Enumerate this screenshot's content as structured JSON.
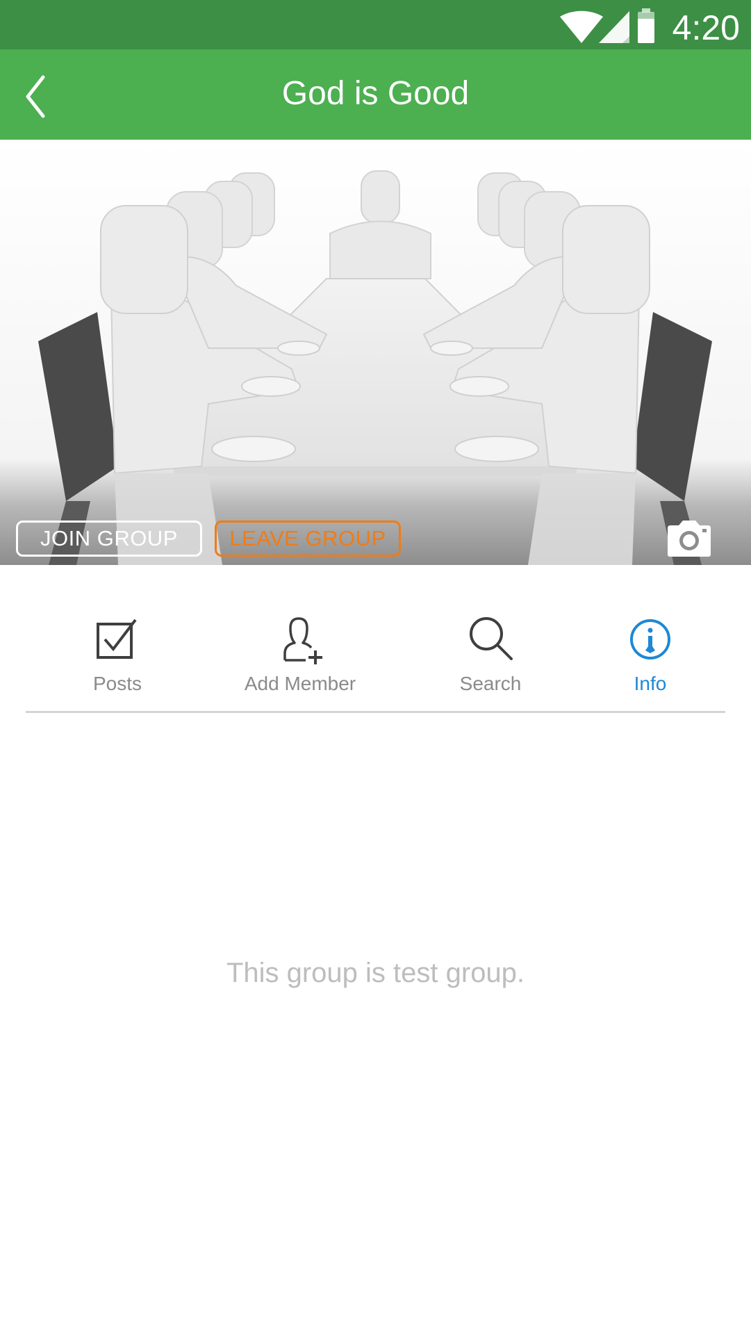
{
  "status_bar": {
    "time": "4:20",
    "icons": [
      "wifi-icon",
      "cell-signal-icon",
      "battery-icon"
    ]
  },
  "app_bar": {
    "title": "God is Good",
    "back_icon": "chevron-left-icon"
  },
  "hero": {
    "join_label": "JOIN GROUP",
    "leave_label": "LEAVE GROUP",
    "camera_icon": "camera-icon"
  },
  "tabs": [
    {
      "label": "Posts",
      "icon": "checkbox-icon",
      "active": false
    },
    {
      "label": "Add Member",
      "icon": "add-person-icon",
      "active": false
    },
    {
      "label": "Search",
      "icon": "search-icon",
      "active": false
    },
    {
      "label": "Info",
      "icon": "info-icon",
      "active": true
    }
  ],
  "info": {
    "description": "This group is test group."
  },
  "colors": {
    "status_bar": "#3d8f45",
    "app_bar": "#4caf50",
    "leave": "#f07c16",
    "active_tab": "#1e88d6",
    "inactive_tab": "#8a8a8a"
  }
}
